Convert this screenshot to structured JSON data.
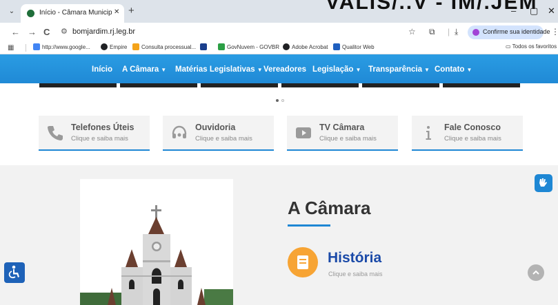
{
  "browser": {
    "tab_title": "Início - Câmara Municipal de B",
    "tab_close": "✕",
    "new_tab": "+",
    "banner_fragment": "VALIS/..V - IM/.JEM",
    "window_controls": {
      "minimize": "–",
      "restore": "▢",
      "close": "✕"
    },
    "nav": {
      "back": "←",
      "forward": "→",
      "reload": "C"
    },
    "url": "bomjardim.rj.leg.br",
    "identity_button": "Confirme sua identidade",
    "bookmarks": [
      {
        "label": "http://www.google...",
        "color": "#4285f4"
      },
      {
        "label": "Empire",
        "color": "#202124"
      },
      {
        "label": "Consulta processual...",
        "color": "#f4a31a"
      },
      {
        "label": "",
        "color": "#1a3f8c"
      },
      {
        "label": "GovNuvem - GOVBR",
        "color": "#2c9f45"
      },
      {
        "label": "Adobe Acrobat",
        "color": "#202124"
      },
      {
        "label": "Qualitor Web",
        "color": "#1f5fbf"
      }
    ],
    "all_bookmarks": "Todos os favoritos"
  },
  "site": {
    "nav": [
      {
        "label": "Início",
        "caret": ""
      },
      {
        "label": "A Câmara",
        "caret": "▼"
      },
      {
        "label": "Matérias Legislativas",
        "caret": "▼"
      },
      {
        "label": "Vereadores",
        "caret": ""
      },
      {
        "label": "Legislação",
        "caret": "▼"
      },
      {
        "label": "Transparência",
        "caret": "▼"
      },
      {
        "label": "Contato",
        "caret": "▼"
      }
    ],
    "cards": [
      {
        "title": "Telefones Úteis",
        "subtitle": "Clique e saiba mais",
        "icon": "phone-icon"
      },
      {
        "title": "Ouvidoria",
        "subtitle": "Clique e saiba mais",
        "icon": "headset-icon"
      },
      {
        "title": "TV Câmara",
        "subtitle": "Clique e saiba mais",
        "icon": "play-icon"
      },
      {
        "title": "Fale Conosco",
        "subtitle": "Clique e saiba mais",
        "icon": "info-icon"
      }
    ],
    "camara": {
      "title": "A Câmara",
      "historia_title": "História",
      "historia_sub": "Clique e saiba mais"
    },
    "colors": {
      "primary": "#1e87d4",
      "accent": "#f7a434",
      "historia": "#1b4aa8"
    }
  }
}
